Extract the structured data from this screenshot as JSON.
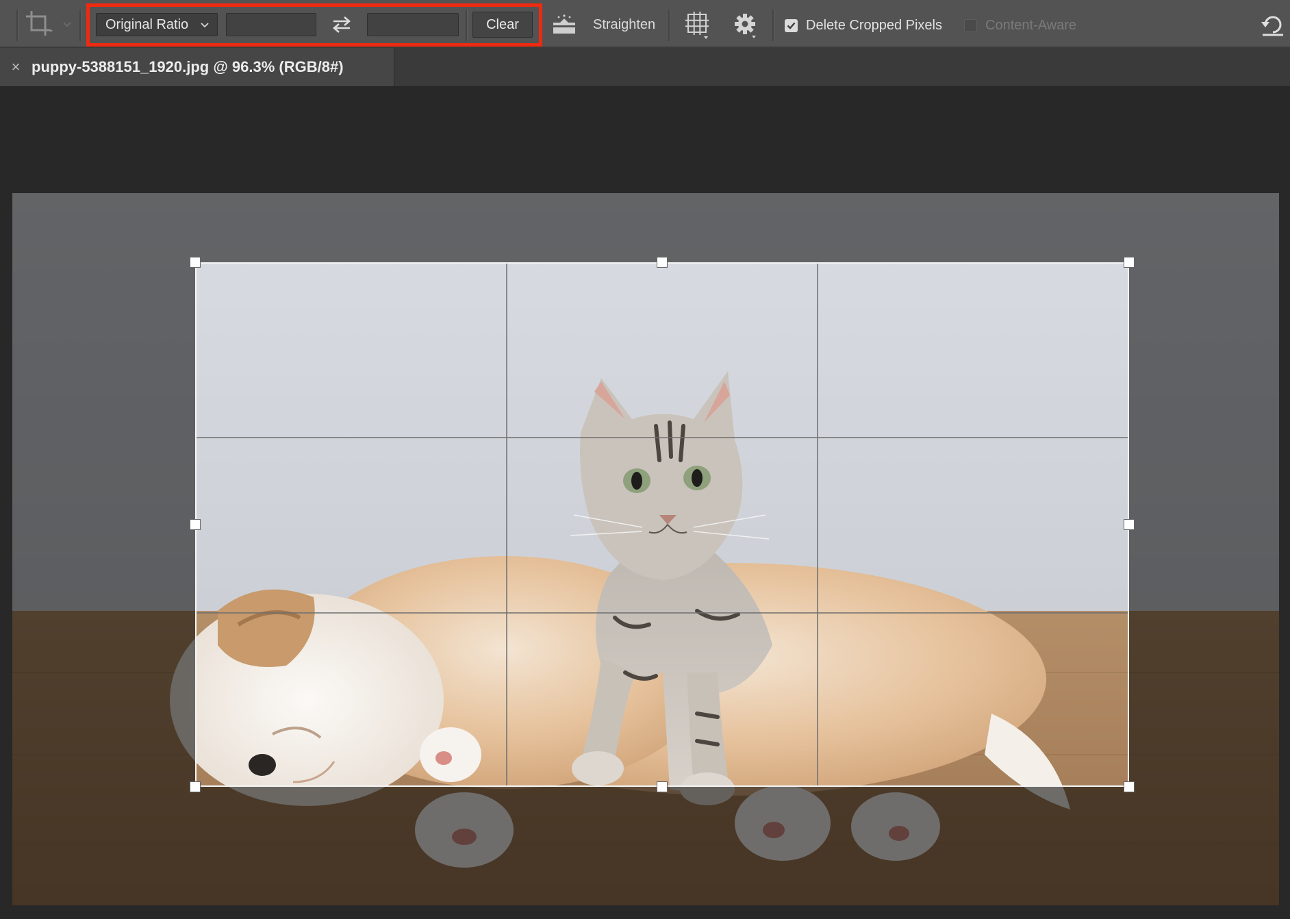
{
  "options_bar": {
    "tool_icon": "crop-icon",
    "ratio_select": {
      "value": "Original Ratio"
    },
    "width_field": {
      "value": "",
      "placeholder": ""
    },
    "height_field": {
      "value": "",
      "placeholder": ""
    },
    "swap_icon": "swap-arrows-icon",
    "clear_label": "Clear",
    "straighten_label": "Straighten",
    "overlay_icon": "grid-overlay-icon",
    "settings_icon": "gear-icon",
    "delete_cropped_pixels": {
      "label": "Delete Cropped Pixels",
      "checked": true
    },
    "content_aware": {
      "label": "Content-Aware",
      "checked": false,
      "enabled": false
    },
    "reset_icon": "reset-icon",
    "highlight_color": "#ee2a10"
  },
  "document": {
    "tab_title": "puppy-5388151_1920.jpg @ 96.3% (RGB/8#)",
    "close_symbol": "×"
  },
  "canvas": {
    "background": "#282828",
    "image_subject": "puppy-and-kitten-photo"
  }
}
